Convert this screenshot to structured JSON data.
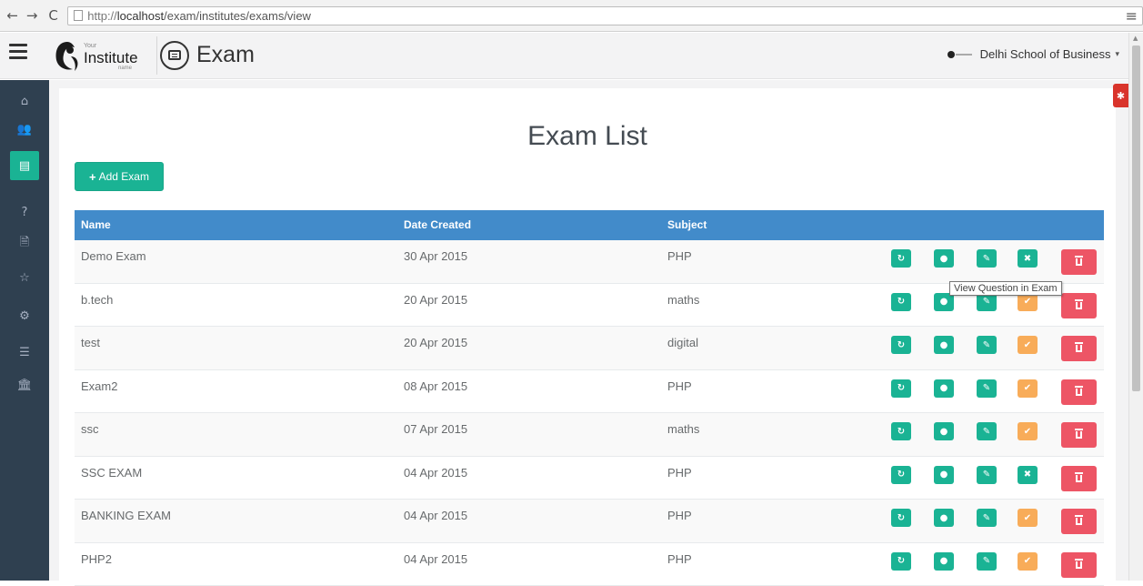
{
  "browser": {
    "back_icon": "←",
    "forward_icon": "→",
    "reload_icon": "C",
    "url_prefix": "http://",
    "url_host": "localhost",
    "url_path": "/exam/institutes/exams/view",
    "menu_icon": "≡"
  },
  "header": {
    "logo_your": "Your",
    "logo_institute": "Institute",
    "logo_name": "name",
    "title": "Exam",
    "organization": "Delhi School of Business",
    "caret": "▾"
  },
  "sidebar": {
    "items": [
      {
        "icon": "home-icon",
        "glyph": "⌂"
      },
      {
        "icon": "users-icon",
        "glyph": "👥"
      },
      {
        "icon": "list-alt-icon",
        "glyph": "▤"
      },
      {
        "icon": "question-icon",
        "glyph": "?"
      },
      {
        "icon": "file-icon",
        "glyph": "🗎"
      },
      {
        "icon": "star-icon",
        "glyph": "☆"
      },
      {
        "icon": "cog-icon",
        "glyph": "⚙"
      },
      {
        "icon": "list-icon",
        "glyph": "☰"
      },
      {
        "icon": "institution-icon",
        "glyph": "🏛"
      }
    ],
    "active_index": 2
  },
  "page": {
    "title": "Exam List",
    "add_button": "Add Exam",
    "add_icon": "+"
  },
  "table": {
    "headers": [
      "Name",
      "Date Created",
      "Subject"
    ],
    "rows": [
      {
        "name": "Demo Exam",
        "date": "30 Apr 2015",
        "subject": "PHP",
        "published": false
      },
      {
        "name": "b.tech",
        "date": "20 Apr 2015",
        "subject": "maths",
        "published": true
      },
      {
        "name": "test",
        "date": "20 Apr 2015",
        "subject": "digital",
        "published": true
      },
      {
        "name": "Exam2",
        "date": "08 Apr 2015",
        "subject": "PHP",
        "published": true
      },
      {
        "name": "ssc",
        "date": "07 Apr 2015",
        "subject": "maths",
        "published": true
      },
      {
        "name": "SSC EXAM",
        "date": "04 Apr 2015",
        "subject": "PHP",
        "published": false
      },
      {
        "name": "BANKING EXAM",
        "date": "04 Apr 2015",
        "subject": "PHP",
        "published": true
      },
      {
        "name": "PHP2",
        "date": "04 Apr 2015",
        "subject": "PHP",
        "published": true
      }
    ],
    "action_glyphs": {
      "refresh": "↻",
      "view": "●",
      "edit": "✎",
      "check": "✔",
      "cross": "✖"
    }
  },
  "tooltip": "View Question in Exam",
  "bug_badge": "✱",
  "colors": {
    "sidebar": "#2f4050",
    "accent": "#1ab394",
    "table_header": "#428bca",
    "warning": "#f8ac59",
    "danger": "#ed5565"
  }
}
